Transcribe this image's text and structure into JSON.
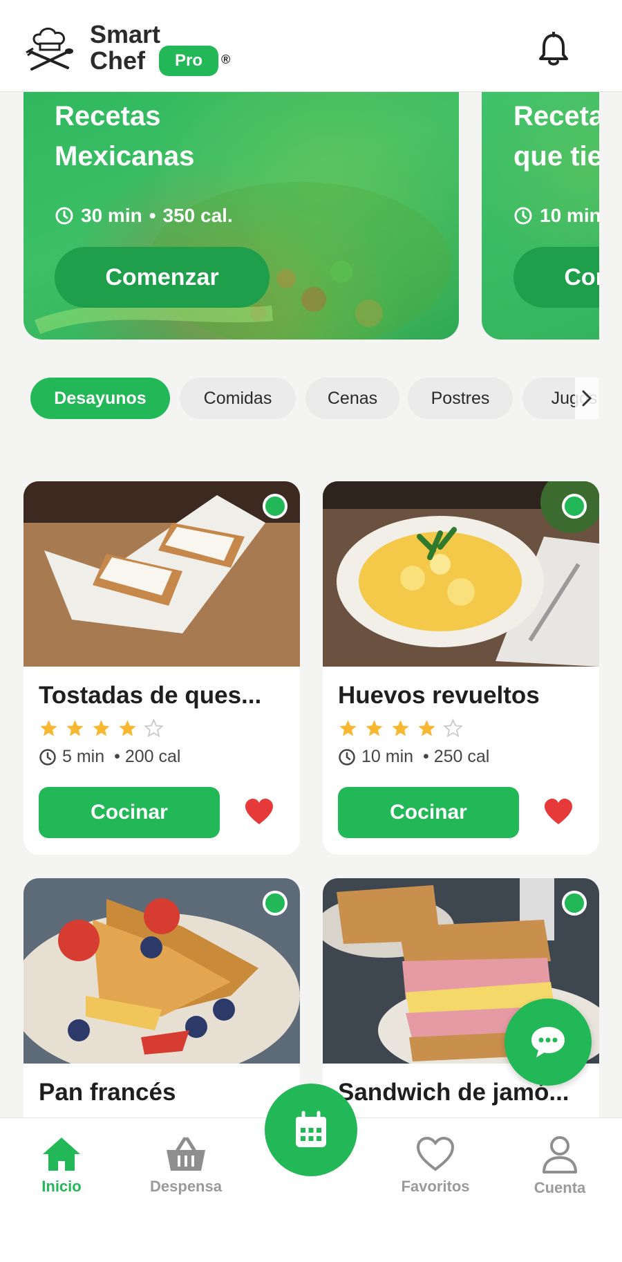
{
  "header": {
    "brand_line1": "Smart",
    "brand_line2": "Chef",
    "pro_badge": "Pro",
    "registered_mark": "®"
  },
  "hero_cards": [
    {
      "title": "Recetas\nMexicanas",
      "time": "30 min",
      "calories": "350 cal.",
      "button": "Comenzar"
    },
    {
      "title": "Recetas\nque tienes",
      "time": "10 min",
      "calories": "",
      "button": "Comenzar"
    }
  ],
  "categories": [
    "Desayunos",
    "Comidas",
    "Cenas",
    "Postres",
    "Jugos"
  ],
  "active_category": "Desayunos",
  "recipes": [
    {
      "title": "Tostadas de ques...",
      "rating": 4,
      "max_rating": 5,
      "time": "5 min",
      "calories": "• 200 cal",
      "button": "Cocinar",
      "favorite": true
    },
    {
      "title": "Huevos revueltos",
      "rating": 4,
      "max_rating": 5,
      "time": "10 min",
      "calories": "• 250 cal",
      "button": "Cocinar",
      "favorite": true
    },
    {
      "title": "Pan francés"
    },
    {
      "title": "Sandwich de jamó..."
    }
  ],
  "bottom_nav": [
    {
      "label": "Inicio",
      "icon": "home-icon",
      "active": true
    },
    {
      "label": "Despensa",
      "icon": "basket-icon",
      "active": false
    },
    {
      "label": "Favoritos",
      "icon": "heart-icon",
      "active": false
    },
    {
      "label": "Cuenta",
      "icon": "user-icon",
      "active": false
    }
  ],
  "colors": {
    "brand_green": "#22b757",
    "star_yellow": "#f7b731",
    "heart_red": "#e63939"
  }
}
